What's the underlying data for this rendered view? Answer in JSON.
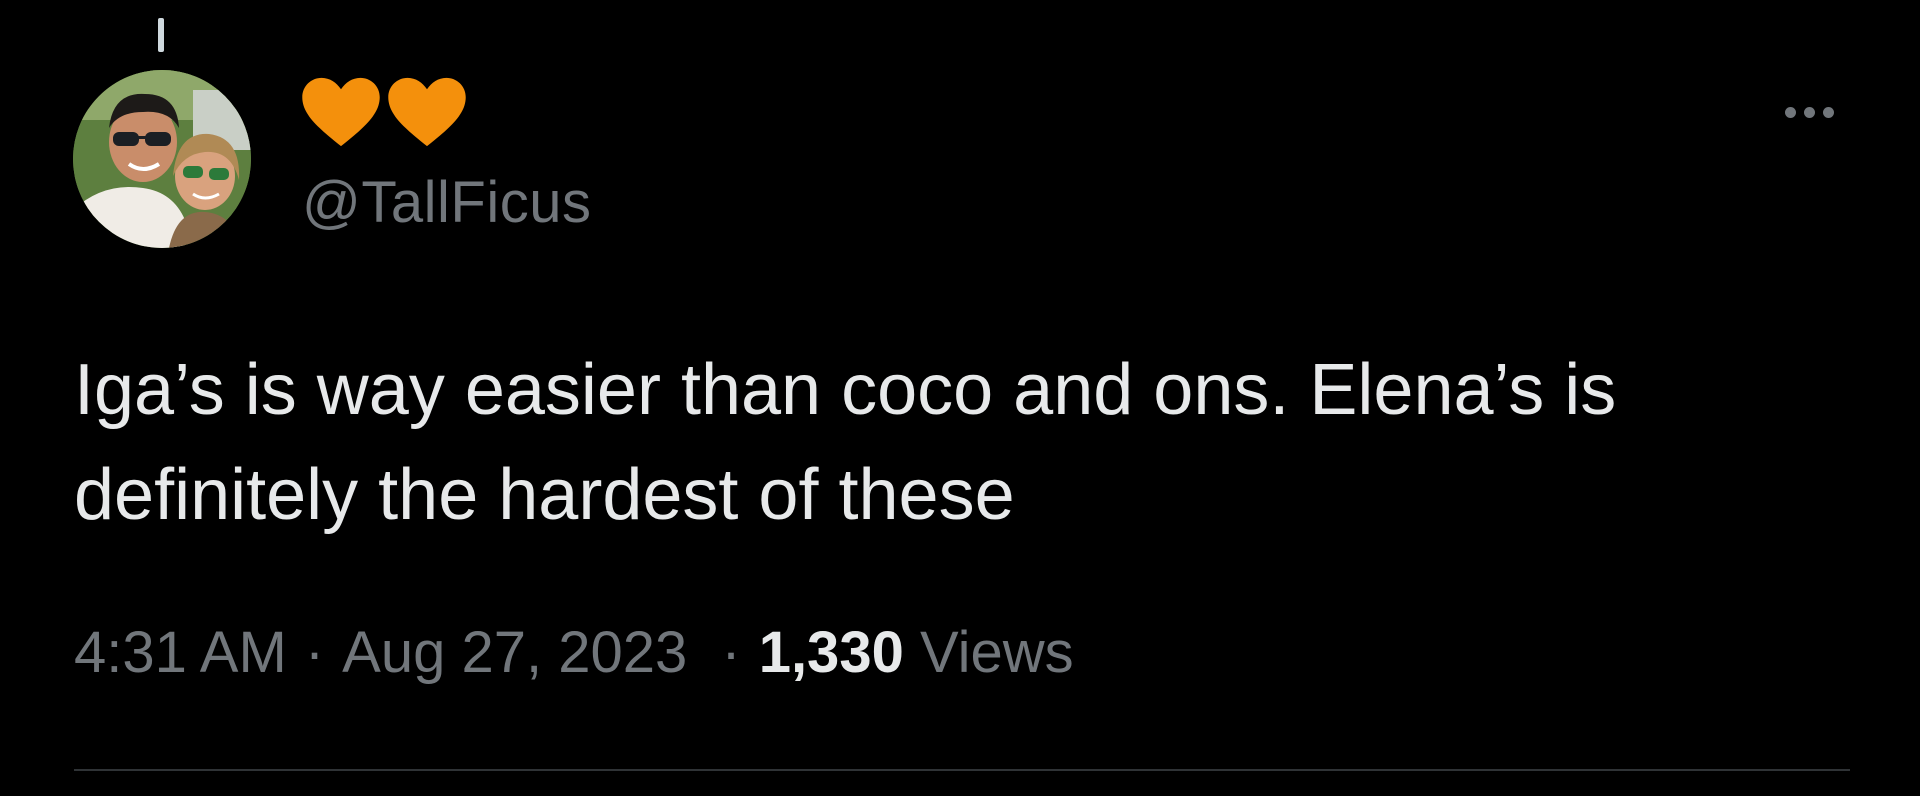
{
  "tweet": {
    "display_name_icons": [
      "orange-heart-icon",
      "orange-heart-icon"
    ],
    "handle": "@TallFicus",
    "text": "Iga’s is way easier than coco and ons. Elena’s is\ndefinitely the hardest of these",
    "time": "4:31 AM",
    "separator": "·",
    "date": "Aug 27, 2023",
    "views_count": "1,330",
    "views_label": "Views",
    "more_icon": "more-horizontal-icon"
  },
  "colors": {
    "background": "#000000",
    "primary_text": "#e7e9ea",
    "secondary_text": "#71767b",
    "heart": "#f4900c",
    "divider": "#2f3336"
  }
}
